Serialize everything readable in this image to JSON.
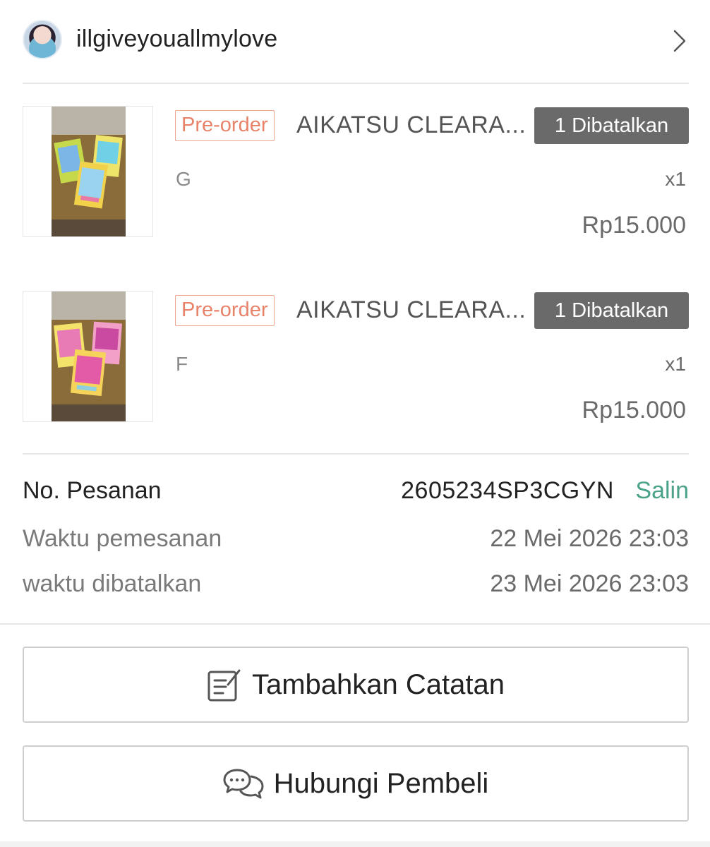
{
  "header": {
    "username": "illgiveyouallmylove"
  },
  "items": [
    {
      "tag": "Pre-order",
      "name": "AIKATSU CLEARA...",
      "status": "1 Dibatalkan",
      "variant": "G",
      "qty": "x1",
      "price": "Rp15.000"
    },
    {
      "tag": "Pre-order",
      "name": "AIKATSU CLEARA...",
      "status": "1 Dibatalkan",
      "variant": "F",
      "qty": "x1",
      "price": "Rp15.000"
    }
  ],
  "order": {
    "number_label": "No. Pesanan",
    "number": "2605234SP3CGYN",
    "copy_label": "Salin",
    "order_time_label": "Waktu pemesanan",
    "order_time": "22 Mei 2026 23:03",
    "cancel_time_label": "waktu dibatalkan",
    "cancel_time": "23 Mei 2026 23:03"
  },
  "actions": {
    "add_note": "Tambahkan Catatan",
    "contact_buyer": "Hubungi Pembeli"
  },
  "colors": {
    "accent_green": "#4aa389",
    "preorder": "#e8836a",
    "status_bg": "#6a6a6a"
  }
}
